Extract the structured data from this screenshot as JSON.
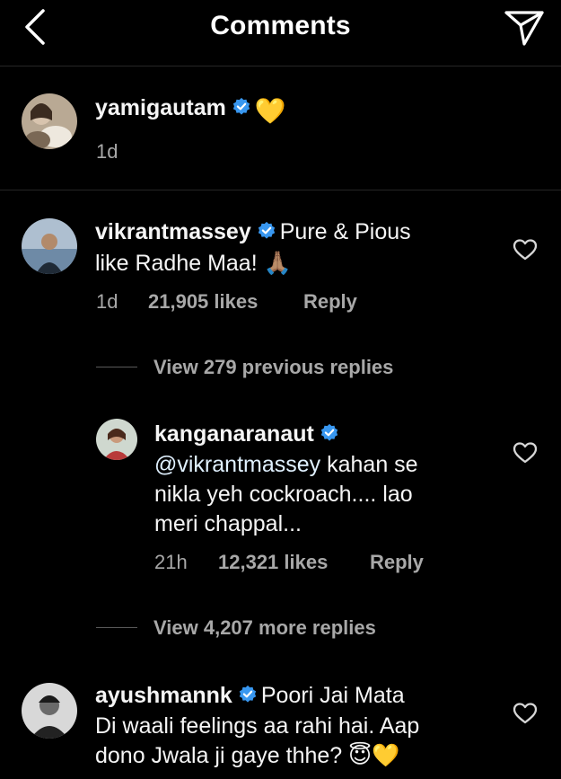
{
  "header": {
    "title": "Comments",
    "back_icon": "chevron-left-icon",
    "send_icon": "paper-plane-icon"
  },
  "caption": {
    "username": "yamigautam",
    "text": "💛",
    "time": "1d"
  },
  "comments": [
    {
      "username": "vikrantmassey",
      "text_line1": "Pure & Pious",
      "text_line2": "like Radhe Maa! 🙏🏽",
      "time": "1d",
      "likes": "21,905 likes",
      "reply": "Reply",
      "view_replies": "View 279 previous replies",
      "replies": [
        {
          "username": "kanganaranaut",
          "mention": "@vikrantmassey",
          "text_after_mention": " kahan se",
          "text_line2": "nikla yeh cockroach.... lao",
          "text_line3": "meri chappal...",
          "time": "21h",
          "likes": "12,321 likes",
          "reply": "Reply"
        }
      ],
      "view_more": "View 4,207 more replies"
    },
    {
      "username": "ayushmannk",
      "text_line1": "Poori Jai Mata",
      "text_line2": "Di waali feelings aa rahi hai. Aap",
      "text_line3": "dono Jwala ji gaye thhe? 😇💛"
    }
  ],
  "colors": {
    "background": "#000000",
    "text": "#f5f5f5",
    "secondary": "#a8a8a8",
    "verified": "#3897f0",
    "divider": "#262626"
  }
}
